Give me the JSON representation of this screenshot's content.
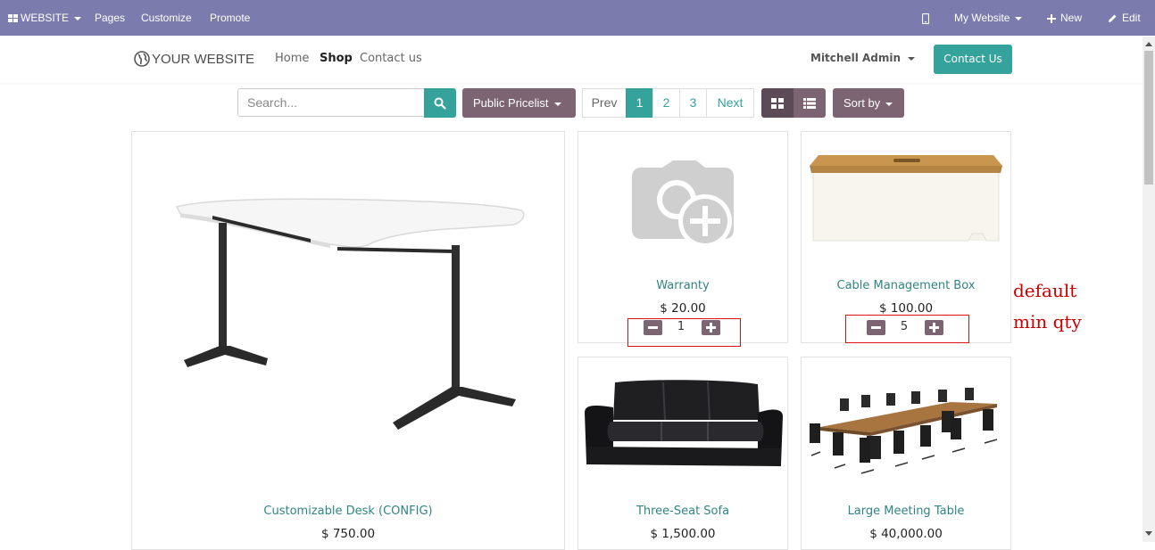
{
  "admin_bar": {
    "website_menu": "WEBSITE",
    "pages": "Pages",
    "customize": "Customize",
    "promote": "Promote",
    "my_website": "My Website",
    "new": "New",
    "edit": "Edit"
  },
  "header": {
    "logo_text": "YOUR WEBSITE",
    "nav": [
      "Home",
      "Shop",
      "Contact us"
    ],
    "active_nav": "Shop",
    "user": "Mitchell Admin",
    "contact_button": "Contact Us"
  },
  "toolbar": {
    "search_placeholder": "Search...",
    "pricelist": "Public Pricelist",
    "pager": {
      "prev": "Prev",
      "pages": [
        "1",
        "2",
        "3"
      ],
      "current": "1",
      "next": "Next"
    },
    "sort_by": "Sort by"
  },
  "products": [
    {
      "name": "Customizable Desk (CONFIG)",
      "price": "$ 750.00"
    },
    {
      "name": "Warranty",
      "price": "$ 20.00",
      "qty": "1"
    },
    {
      "name": "Cable Management Box",
      "price": "$ 100.00",
      "qty": "5"
    },
    {
      "name": "Three-Seat Sofa",
      "price": "$ 1,500.00"
    },
    {
      "name": "Large Meeting Table",
      "price": "$ 40,000.00"
    }
  ],
  "annotation": {
    "line1": "default",
    "line2": "min qty"
  },
  "colors": {
    "admin_bar": "#7c7bad",
    "primary": "#35a39b",
    "secondary": "#7d6472",
    "annotation": "#cc0000"
  }
}
